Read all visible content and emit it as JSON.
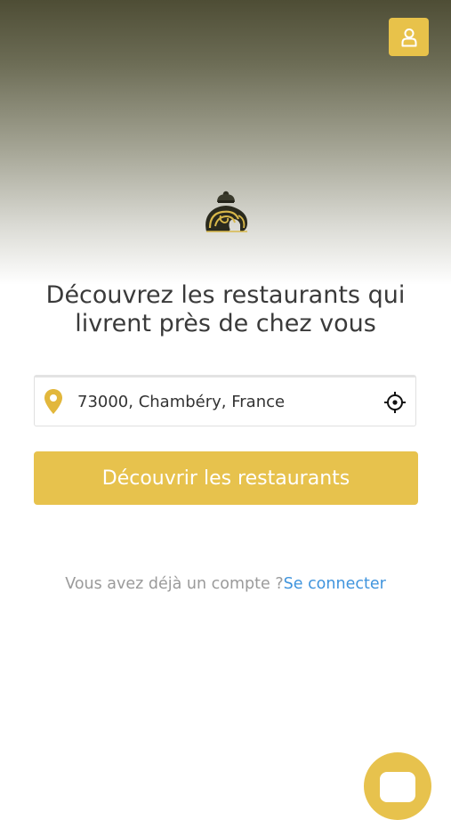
{
  "header": {
    "account_icon": "user-icon"
  },
  "brand": {
    "logo_icon": "elephant-chef-logo"
  },
  "hero": {
    "headline_line1": "Découvrez les restaurants qui",
    "headline_line2": "livrent près de chez vous"
  },
  "search": {
    "pin_icon": "map-pin-icon",
    "address_value": "73000, Chambéry, France",
    "locate_icon": "crosshair-icon"
  },
  "cta": {
    "label": "Découvrir les restaurants"
  },
  "login": {
    "question": "Vous avez déjà un compte ?",
    "link": "Se connecter"
  },
  "chat": {
    "icon": "chat-bubble-icon"
  },
  "colors": {
    "accent": "#e7c24d",
    "link": "#3f94dd",
    "heading": "#3a3a3a"
  }
}
